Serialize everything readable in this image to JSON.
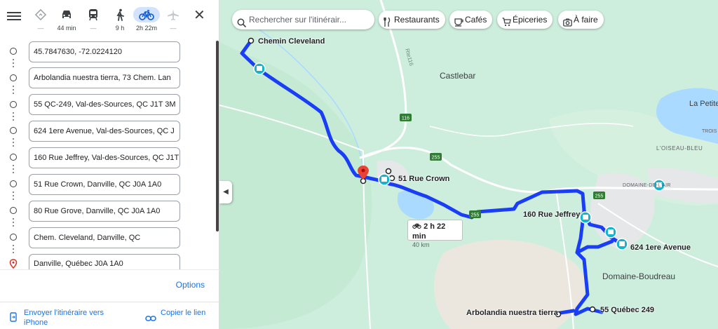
{
  "travel_modes": [
    {
      "name": "best",
      "label": "—"
    },
    {
      "name": "car",
      "label": "44 min"
    },
    {
      "name": "transit",
      "label": "—"
    },
    {
      "name": "walk",
      "label": "9 h"
    },
    {
      "name": "bike",
      "label": "2h 22m"
    },
    {
      "name": "flight",
      "label": "—"
    }
  ],
  "stops": [
    {
      "value": "45.7847630, -72.0224120"
    },
    {
      "value": "Arbolandia nuestra tierra, 73 Chem. Lan"
    },
    {
      "value": "55 QC-249, Val-des-Sources, QC J1T 3M"
    },
    {
      "value": "624 1ere Avenue, Val-des-Sources, QC J"
    },
    {
      "value": "160 Rue Jeffrey, Val-des-Sources, QC J1T"
    },
    {
      "value": "51 Rue Crown, Danville, QC J0A 1A0"
    },
    {
      "value": "80 Rue Grove, Danville, QC J0A 1A0"
    },
    {
      "value": "Chem. Cleveland, Danville, QC"
    },
    {
      "value": "Danville, Québec J0A 1A0"
    }
  ],
  "options_label": "Options",
  "send_to_phone": "Envoyer l'itinéraire vers iPhone",
  "copy_link": "Copier le lien",
  "search_placeholder": "Rechercher sur l'itinérair...",
  "chips": {
    "restaurants": "Restaurants",
    "cafes": "Cafés",
    "groceries": "Épiceries",
    "todo": "À faire"
  },
  "map_labels": {
    "chemin_cleveland": "Chemin Cleveland",
    "rue_crown": "51 Rue Crown",
    "rue_jeffrey": "160 Rue Jeffrey",
    "avenue": "624 1ere Avenue",
    "arbolandia": "Arbolandia nuestra tierra",
    "quebec249": "55 Québec 249",
    "castlebar": "Castlebar",
    "domaine_boudreau": "Domaine-Boudreau",
    "la_petite": "La Petite",
    "loiseau_bleu": "L'OISEAU-BLEU",
    "domaine_air": "DOMAINE-DE-L'AIR",
    "trois": "TROIS",
    "rte116": "Rte116"
  },
  "road_shields": [
    "116",
    "255",
    "255",
    "255"
  ],
  "route_summary": {
    "time": "2 h 22 min",
    "distance": "40 km"
  },
  "colors": {
    "route": "#1a3ef5",
    "map_bg": "#cdeedd",
    "water": "#aadaff",
    "accent": "#1a73e8"
  }
}
